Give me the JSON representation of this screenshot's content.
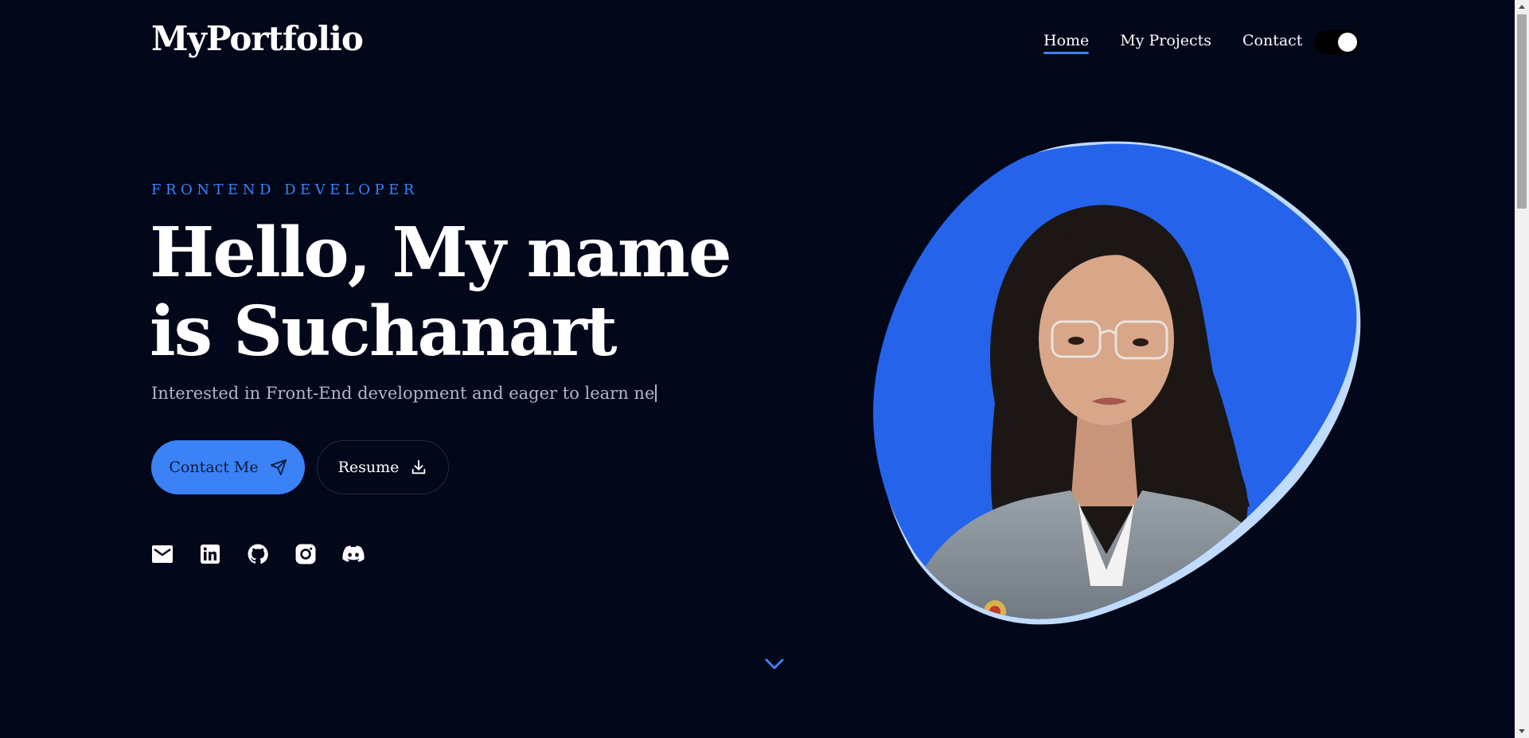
{
  "header": {
    "logo": "MyPortfolio",
    "nav": [
      {
        "label": "Home",
        "active": true
      },
      {
        "label": "My Projects",
        "active": false
      },
      {
        "label": "Contact",
        "active": false
      }
    ],
    "theme_toggle": {
      "state": "on"
    }
  },
  "hero": {
    "eyebrow": "FRONTEND DEVELOPER",
    "title_line1": "Hello, My name",
    "title_line2": "is Suchanart",
    "subtitle": "Interested in Front-End development and eager to learn ne",
    "buttons": {
      "contact": {
        "label": "Contact Me",
        "icon": "paper-plane-icon"
      },
      "resume": {
        "label": "Resume",
        "icon": "download-icon"
      }
    },
    "socials": [
      "email-icon",
      "linkedin-icon",
      "github-icon",
      "instagram-icon",
      "discord-icon"
    ]
  },
  "portrait": {
    "description_icon": "profile-photo",
    "blob_color": "#2563eb",
    "blob_back_color": "#bfdbfe"
  },
  "colors": {
    "background": "#02071a",
    "accent": "#3b82f6",
    "text": "#ffffff",
    "muted": "#aeb6c4"
  }
}
